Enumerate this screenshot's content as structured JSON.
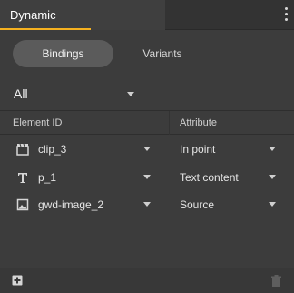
{
  "panel": {
    "title": "Dynamic",
    "menu_icon": "more-vert-icon"
  },
  "tabs": [
    {
      "label": "Bindings",
      "active": true
    },
    {
      "label": "Variants",
      "active": false
    }
  ],
  "filter": {
    "selected": "All"
  },
  "columns": {
    "element_id": "Element ID",
    "attribute": "Attribute"
  },
  "rows": [
    {
      "icon": "film-clip-icon",
      "element_id": "clip_3",
      "attribute": "In point"
    },
    {
      "icon": "text-icon",
      "element_id": "p_1",
      "attribute": "Text content"
    },
    {
      "icon": "image-icon",
      "element_id": "gwd-image_2",
      "attribute": "Source"
    }
  ],
  "footer": {
    "add_icon": "add-icon",
    "delete_icon": "trash-icon"
  },
  "colors": {
    "accent": "#f5b120",
    "background": "#3c3c3c",
    "header": "#333333"
  }
}
